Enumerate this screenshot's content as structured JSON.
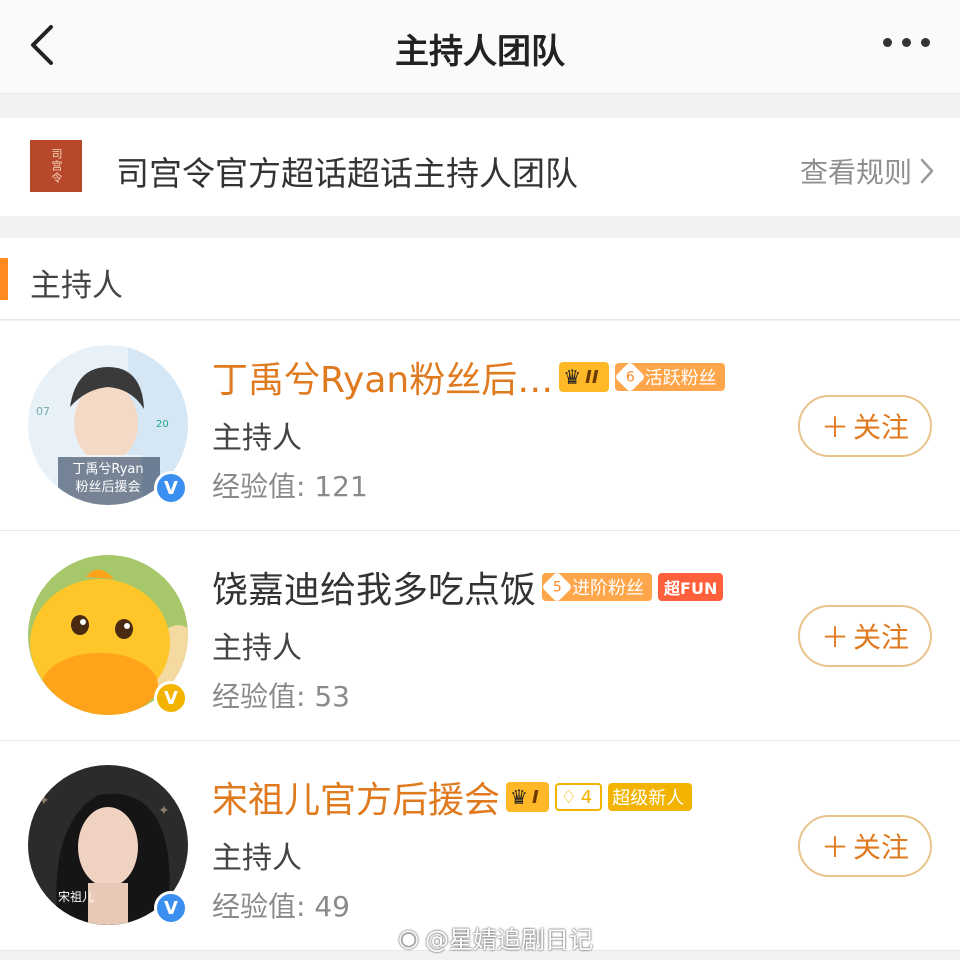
{
  "header": {
    "title": "主持人团队",
    "back_icon": "chevron-left-icon",
    "more_icon": "more-dots-icon"
  },
  "group": {
    "logo_text": "司宫令",
    "name": "司宫令官方超话超话主持人团队",
    "rules_label": "查看规则"
  },
  "section": {
    "label": "主持人"
  },
  "members": [
    {
      "name": "丁禹兮Ryan粉丝后…",
      "crown_level": "II",
      "fan_level": "6",
      "fan_label": "活跃粉丝",
      "role": "主持人",
      "exp_label": "经验值: ",
      "exp_value": "121",
      "verified": "blue",
      "avatar_caption_1": "丁禹兮Ryan",
      "avatar_caption_2": "粉丝后援会",
      "follow_label": "关注"
    },
    {
      "name": "饶嘉迪给我多吃点饭",
      "fan_level": "5",
      "fan_label": "进阶粉丝",
      "extra_tag": "超FUN",
      "role": "主持人",
      "exp_label": "经验值: ",
      "exp_value": "53",
      "verified": "gold",
      "follow_label": "关注"
    },
    {
      "name": "宋祖儿官方后援会",
      "crown_level": "I",
      "fan_level": "4",
      "fan_label": "超级新人",
      "role": "主持人",
      "exp_label": "经验值: ",
      "exp_value": "49",
      "verified": "blue",
      "avatar_caption_1": "宋祖儿",
      "follow_label": "关注"
    }
  ],
  "watermark": "@星婧追剧日记",
  "colors": {
    "accent": "#e07a1f",
    "section_bar": "#ff8a20",
    "follow_border": "#e9c38c",
    "verified_blue": "#3b8ff0",
    "verified_gold": "#f2b400"
  }
}
